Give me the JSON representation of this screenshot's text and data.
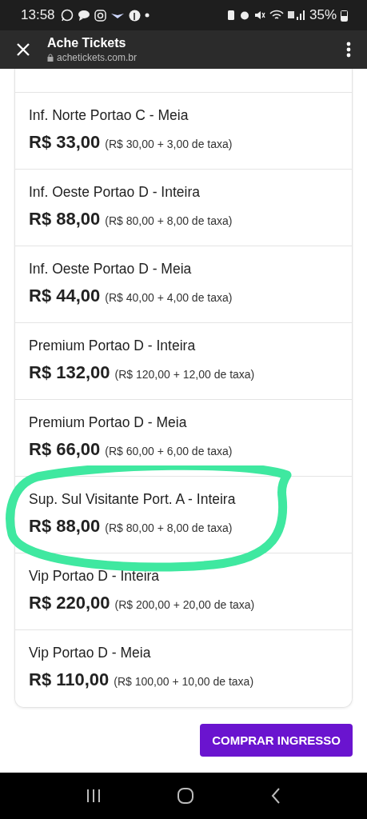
{
  "status_bar": {
    "time": "13:58",
    "battery": "35%"
  },
  "toolbar": {
    "title": "Ache Tickets",
    "url": "achetickets.com.br"
  },
  "tickets": [
    {
      "name": "Inf. Norte Portao C - Meia",
      "price": "R$ 33,00",
      "breakdown": "(R$ 30,00 + 3,00 de taxa)",
      "highlighted": false
    },
    {
      "name": "Inf. Oeste Portao D - Inteira",
      "price": "R$ 88,00",
      "breakdown": "(R$ 80,00 + 8,00 de taxa)",
      "highlighted": false
    },
    {
      "name": "Inf. Oeste Portao D - Meia",
      "price": "R$ 44,00",
      "breakdown": "(R$ 40,00 + 4,00 de taxa)",
      "highlighted": false
    },
    {
      "name": "Premium Portao D - Inteira",
      "price": "R$ 132,00",
      "breakdown": "(R$ 120,00 + 12,00 de taxa)",
      "highlighted": false
    },
    {
      "name": "Premium Portao D - Meia",
      "price": "R$ 66,00",
      "breakdown": "(R$ 60,00 + 6,00 de taxa)",
      "highlighted": false
    },
    {
      "name": "Sup. Sul Visitante Port. A - Inteira",
      "price": "R$ 88,00",
      "breakdown": "(R$ 80,00 + 8,00 de taxa)",
      "highlighted": true
    },
    {
      "name": "Vip Portao D - Inteira",
      "price": "R$ 220,00",
      "breakdown": "(R$ 200,00 + 20,00 de taxa)",
      "highlighted": false
    },
    {
      "name": "Vip Portao D - Meia",
      "price": "R$ 110,00",
      "breakdown": "(R$ 100,00 + 10,00 de taxa)",
      "highlighted": false
    }
  ],
  "button": "COMPRAR INGRESSO"
}
